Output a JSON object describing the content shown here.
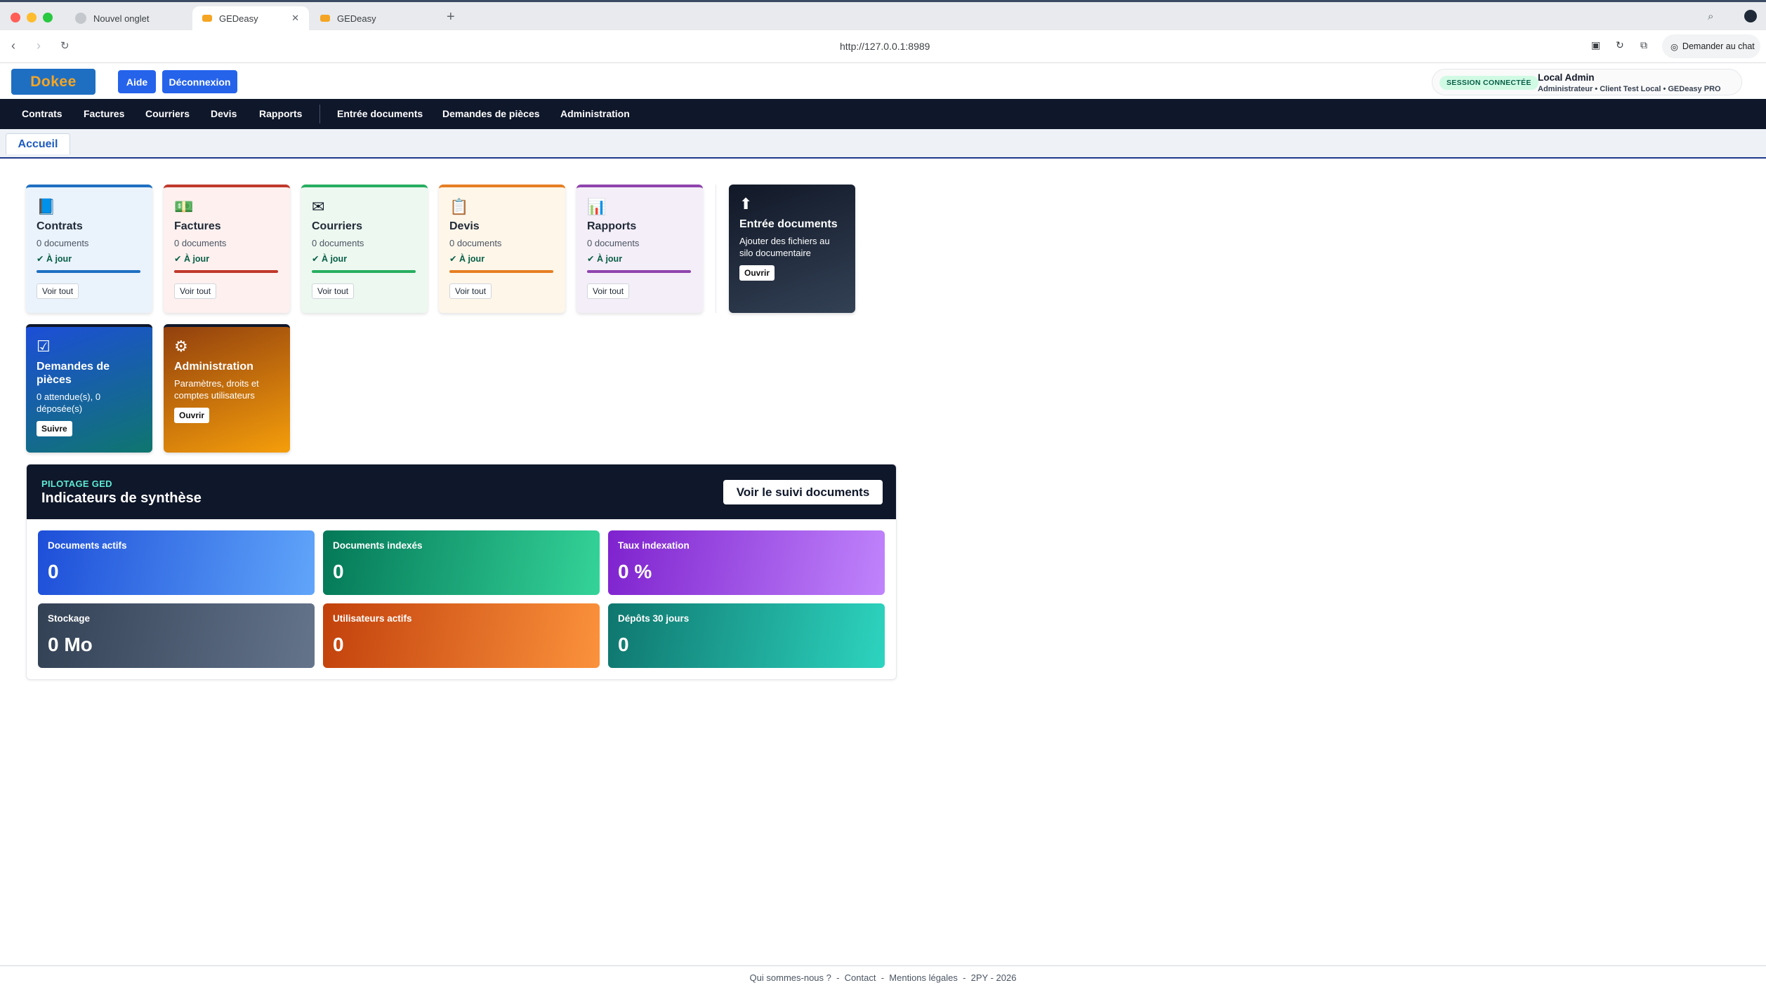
{
  "browser": {
    "tabs": [
      {
        "title": "Nouvel onglet"
      },
      {
        "title": "GEDeasy"
      },
      {
        "title": "GEDeasy"
      }
    ],
    "url": "http://127.0.0.1:8989",
    "chat_button": "Demander au chat"
  },
  "header": {
    "logo": "Dokee",
    "help_label": "Aide",
    "logout_label": "Déconnexion",
    "session_badge": "SESSION CONNECTÉE",
    "user_name": "Local Admin",
    "user_meta": "Administrateur  •  Client Test Local  •  GEDeasy PRO"
  },
  "nav": {
    "items": [
      "Contrats",
      "Factures",
      "Courriers",
      "Devis",
      "Rapports",
      "Entrée documents",
      "Demandes de pièces",
      "Administration"
    ]
  },
  "page_tab": "Accueil",
  "tiles": [
    {
      "title": "Contrats",
      "count": "0 documents",
      "status": "✔ À jour",
      "button": "Voir tout",
      "icon": "book-icon",
      "color": "#1e6fc2"
    },
    {
      "title": "Factures",
      "count": "0 documents",
      "status": "✔ À jour",
      "button": "Voir tout",
      "icon": "money-icon",
      "color": "#c0392b"
    },
    {
      "title": "Courriers",
      "count": "0 documents",
      "status": "✔ À jour",
      "button": "Voir tout",
      "icon": "envelope-icon",
      "color": "#27ae60"
    },
    {
      "title": "Devis",
      "count": "0 documents",
      "status": "✔ À jour",
      "button": "Voir tout",
      "icon": "clipboard-icon",
      "color": "#e67e22"
    },
    {
      "title": "Rapports",
      "count": "0 documents",
      "status": "✔ À jour",
      "button": "Voir tout",
      "icon": "bar-chart-icon",
      "color": "#8e44ad"
    }
  ],
  "upload_tile": {
    "title": "Entrée documents",
    "desc": "Ajouter des fichiers au silo documentaire",
    "button": "Ouvrir",
    "icon": "arrow-up-icon"
  },
  "requests_tile": {
    "title": "Demandes de pièces",
    "desc": "0 attendue(s), 0 déposée(s)",
    "button": "Suivre",
    "icon": "checkbox-icon"
  },
  "admin_tile": {
    "title": "Administration",
    "desc": "Paramètres, droits et comptes utilisateurs",
    "button": "Ouvrir",
    "icon": "gear-icon"
  },
  "synthesis": {
    "eyebrow": "PILOTAGE GED",
    "title": "Indicateurs de synthèse",
    "button": "Voir le suivi documents",
    "kpis": [
      {
        "label": "Documents actifs",
        "value": "0"
      },
      {
        "label": "Documents indexés",
        "value": "0"
      },
      {
        "label": "Taux indexation",
        "value": "0 %"
      },
      {
        "label": "Stockage",
        "value": "0 Mo"
      },
      {
        "label": "Utilisateurs actifs",
        "value": "0"
      },
      {
        "label": "Dépôts 30 jours",
        "value": "0"
      }
    ]
  },
  "footer": {
    "links": [
      "Qui sommes-nous ?",
      "Contact",
      "Mentions légales"
    ],
    "copyright": "2PY  - 2026"
  }
}
